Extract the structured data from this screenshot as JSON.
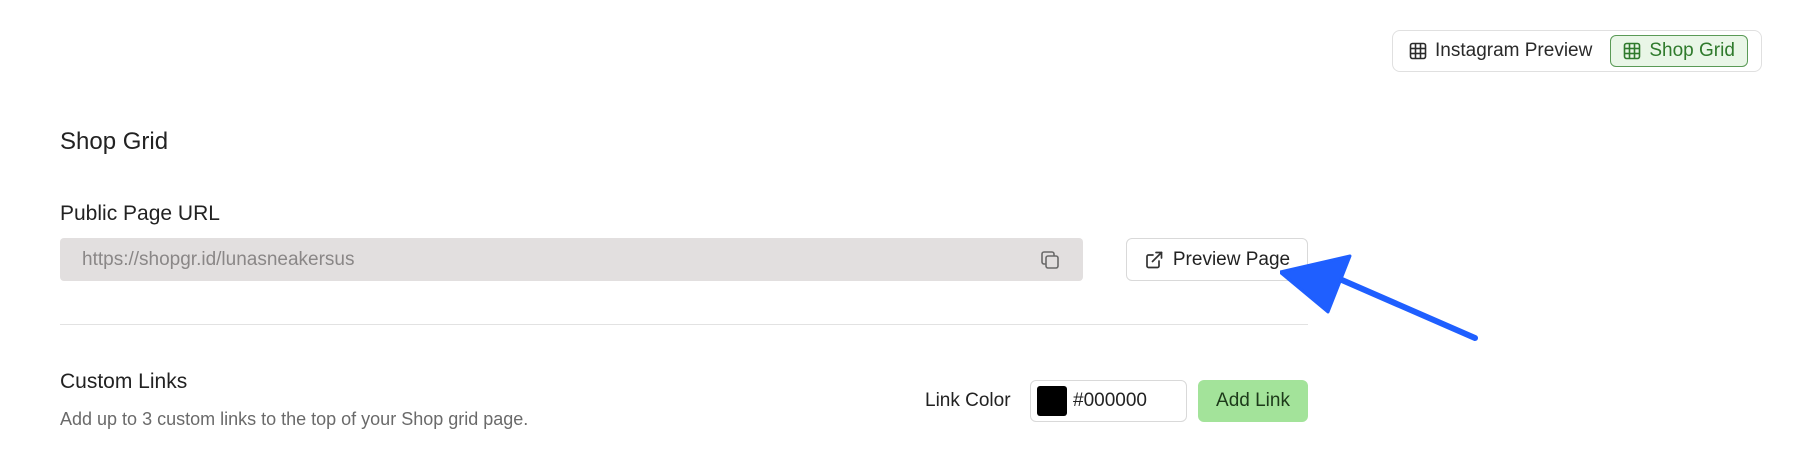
{
  "view_toggle": {
    "instagram_label": "Instagram Preview",
    "shop_grid_label": "Shop Grid",
    "active": "Shop Grid"
  },
  "shop_grid": {
    "title": "Shop Grid",
    "url_label": "Public Page URL",
    "url_value": "https://shopgr.id/lunasneakersus",
    "preview_button": "Preview Page"
  },
  "custom_links": {
    "title": "Custom Links",
    "description": "Add up to 3 custom links to the top of your Shop grid page.",
    "link_color_label": "Link Color",
    "link_color_value": "#000000",
    "add_link_button": "Add Link"
  },
  "colors": {
    "accent_green": "#a3e39a",
    "active_green": "#2f7a2c",
    "annotation_arrow": "#1f5fff"
  },
  "icons": {
    "grid": "grid-icon",
    "copy": "copy-icon",
    "external_link": "external-link-icon"
  }
}
